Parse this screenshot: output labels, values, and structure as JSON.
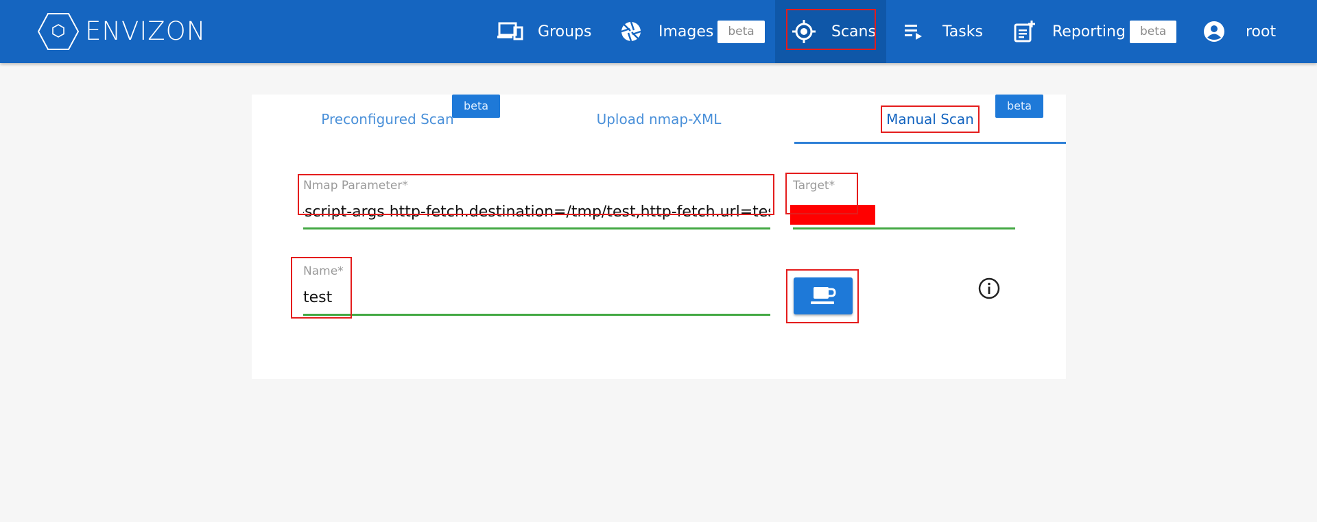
{
  "app": {
    "logo_text": "ENVIZON"
  },
  "nav": {
    "groups_label": "Groups",
    "images_label": "Images",
    "images_badge": "beta",
    "scans_label": "Scans",
    "tasks_label": "Tasks",
    "reporting_label": "Reporting",
    "reporting_badge": "beta",
    "user_label": "root"
  },
  "tabs": {
    "preconfigured_label": "Preconfigured Scan",
    "preconfigured_badge": "beta",
    "upload_label": "Upload nmap-XML",
    "manual_label": "Manual Scan",
    "manual_badge": "beta"
  },
  "form": {
    "nmap_label": "Nmap Parameter*",
    "nmap_value": "-script-args http-fetch.destination=/tmp/test,http-fetch.url=test",
    "target_label": "Target*",
    "target_value": "",
    "name_label": "Name*",
    "name_value": "test"
  },
  "icons": {
    "groups": "devices-icon",
    "images": "camera-aperture-icon",
    "scans": "crosshair-icon",
    "tasks": "playlist-play-icon",
    "reporting": "note-add-icon",
    "user": "account-circle-icon",
    "submit": "coffee-icon",
    "info": "info-icon"
  },
  "colors": {
    "navbar": "#1565c0",
    "accent": "#1e79d8",
    "valid_underline": "#43a843",
    "highlight": "#e41c1c",
    "redaction": "#ff0000"
  }
}
